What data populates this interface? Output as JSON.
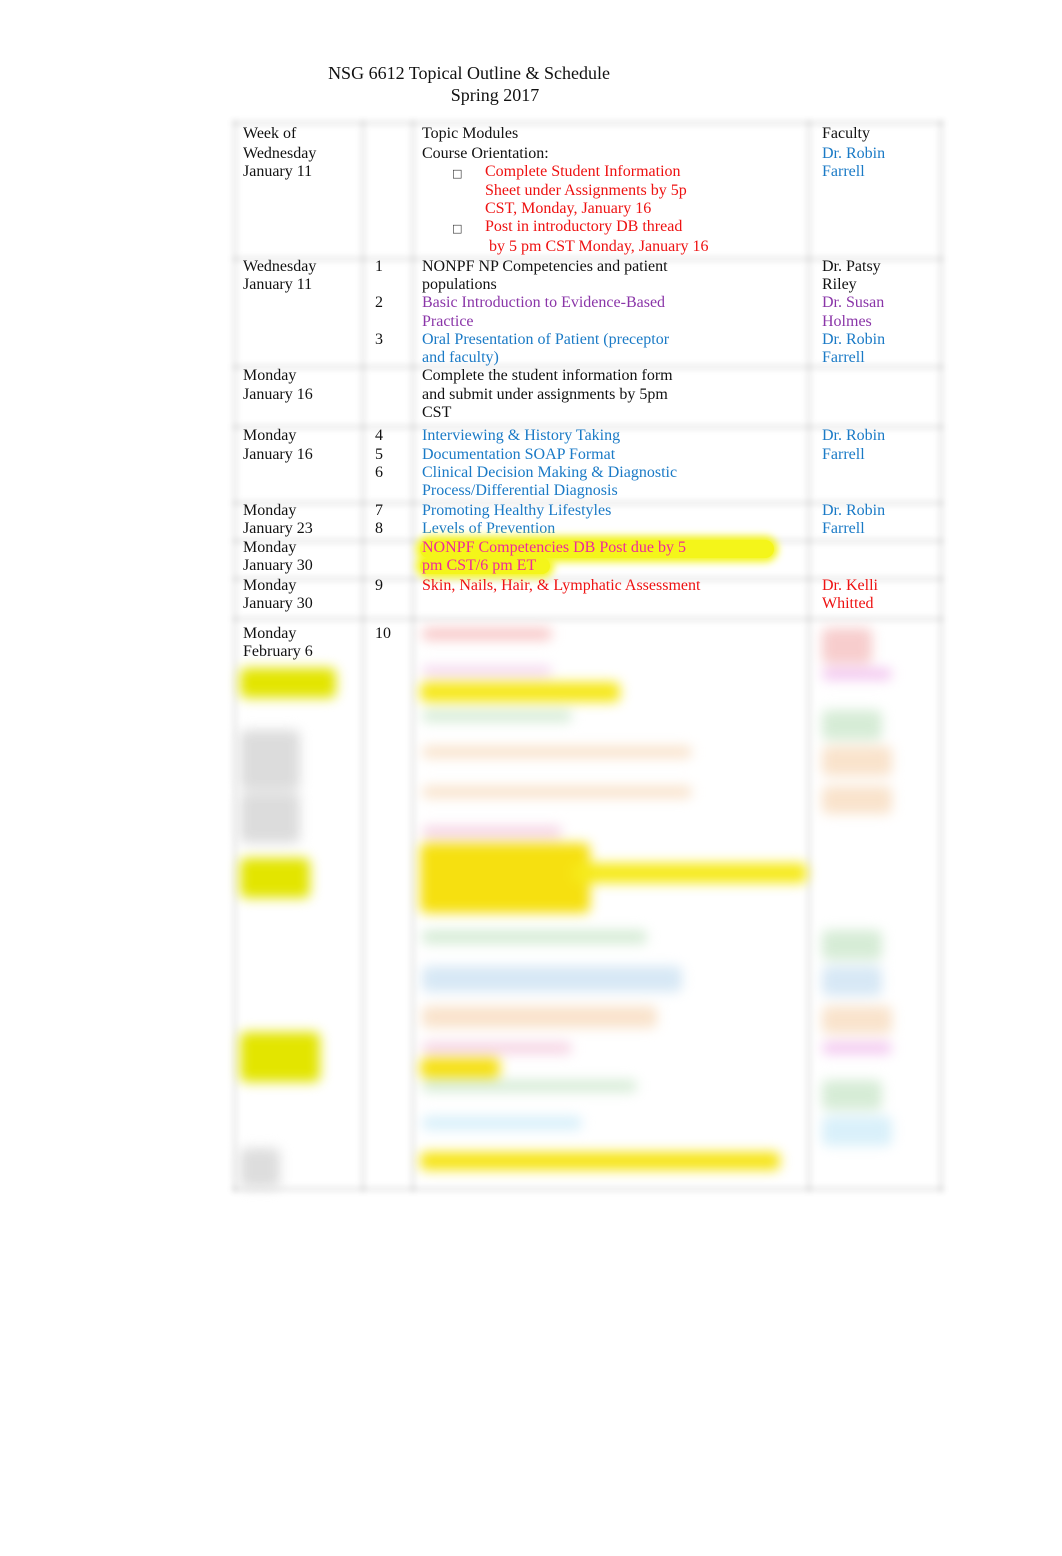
{
  "header": {
    "title": "NSG 6612 Topical Outline & Schedule",
    "subtitle": "Spring 2017"
  },
  "table": {
    "columns": [
      "Week of",
      "",
      "Topic Modules",
      "Faculty"
    ],
    "rows": [
      {
        "date": [
          "Wednesday",
          "January 11"
        ],
        "modules": [],
        "topics": [
          {
            "text": "Course Orientation:",
            "color": "black"
          },
          {
            "bullet": "□",
            "lines": [
              "Complete Student Information",
              "Sheet under Assignments by 5p",
              "CST, Monday, January 16"
            ],
            "color": "red"
          },
          {
            "bullet": "□",
            "lines": [
              "Post in introductory DB thread",
              " by 5 pm CST Monday, January 16"
            ],
            "color": "red"
          }
        ],
        "faculty": [
          {
            "lines": [
              "Dr. Robin",
              "Farrell"
            ],
            "color": "blue"
          }
        ]
      },
      {
        "date": [
          "Wednesday",
          "January 11"
        ],
        "modules": [
          "1",
          "2",
          "3"
        ],
        "topics": [
          {
            "lines": [
              "NONPF NP Competencies and patient",
              "populations"
            ],
            "color": "black"
          },
          {
            "lines": [
              "Basic Introduction to Evidence-Based",
              "Practice"
            ],
            "color": "purple"
          },
          {
            "lines": [
              "Oral Presentation of Patient (preceptor",
              "and faculty)"
            ],
            "color": "blue"
          }
        ],
        "faculty": [
          {
            "lines": [
              "Dr. Patsy",
              "Riley"
            ],
            "color": "black"
          },
          {
            "lines": [
              "Dr. Susan",
              "Holmes"
            ],
            "color": "purple"
          },
          {
            "lines": [
              "Dr. Robin",
              "Farrell"
            ],
            "color": "blue"
          }
        ]
      },
      {
        "date": [
          "Monday",
          "January 16"
        ],
        "modules": [],
        "topics": [
          {
            "lines": [
              "Complete the student information form",
              "and submit under assignments by 5pm",
              "CST"
            ],
            "color": "black"
          }
        ],
        "faculty": []
      },
      {
        "date": [
          "Monday",
          "January 16"
        ],
        "modules": [
          "4",
          "5",
          "6"
        ],
        "topics": [
          {
            "lines": [
              "Interviewing & History Taking"
            ],
            "color": "blue"
          },
          {
            "lines": [
              "Documentation SOAP Format"
            ],
            "color": "blue"
          },
          {
            "lines": [
              "Clinical Decision Making & Diagnostic",
              "Process/Differential Diagnosis"
            ],
            "color": "blue"
          }
        ],
        "faculty": [
          {
            "lines": [
              "Dr. Robin",
              "Farrell"
            ],
            "color": "blue"
          }
        ]
      },
      {
        "date": [
          "Monday",
          "January 23"
        ],
        "modules": [
          "7",
          "8"
        ],
        "topics": [
          {
            "lines": [
              "Promoting Healthy Lifestyles"
            ],
            "color": "blue"
          },
          {
            "lines": [
              "Levels of Prevention"
            ],
            "color": "blue"
          }
        ],
        "faculty": [
          {
            "lines": [
              "Dr. Robin",
              "Farrell"
            ],
            "color": "blue"
          }
        ]
      },
      {
        "date": [
          "Monday",
          "January 30"
        ],
        "modules": [],
        "topics": [
          {
            "lines": [
              "NONPF Competencies DB Post due by 5",
              "pm CST/6 pm ET"
            ],
            "color": "magenta",
            "highlight": true
          }
        ],
        "faculty": []
      },
      {
        "date": [
          "Monday",
          "January 30"
        ],
        "modules": [
          "9"
        ],
        "topics": [
          {
            "lines": [
              "Skin, Nails, Hair, & Lymphatic Assessment"
            ],
            "color": "red"
          }
        ],
        "faculty": [
          {
            "lines": [
              "Dr. Kelli",
              "Whitted"
            ],
            "color": "red"
          }
        ]
      },
      {
        "date": [
          "Monday",
          "February 6"
        ],
        "modules": [
          "10"
        ],
        "topics": [],
        "faculty": []
      }
    ]
  },
  "colors": {
    "black": "#111111",
    "red": "#ee1111",
    "blue": "#1a7ac6",
    "purple": "#8a35a8",
    "magenta": "#ee2a9a",
    "highlight": "#f4f51a"
  }
}
